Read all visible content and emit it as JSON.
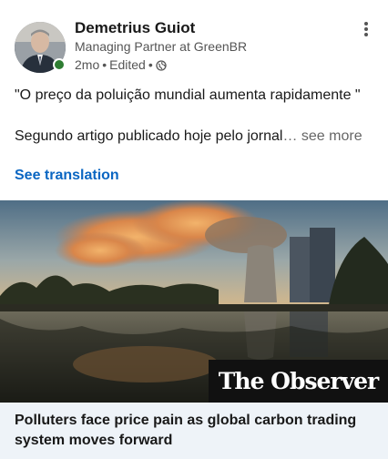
{
  "author": {
    "name": "Demetrius Guiot",
    "headline": "Managing Partner at GreenBR",
    "time": "2mo",
    "edited": "Edited",
    "separator": "•",
    "visibility_icon": "globe-icon"
  },
  "post": {
    "line1": "\"O preço da poluição mundial aumenta rapidamente \"",
    "line2": "Segundo artigo publicado hoje pelo jornal",
    "ellipsis": "…",
    "see_more": "see more",
    "translation": "See translation"
  },
  "article": {
    "publisher": "The Observer",
    "title": "Polluters face price pain as global carbon trading system moves forward"
  },
  "colors": {
    "link_blue": "#0a66c2",
    "presence_green": "#2e7d32",
    "caption_bg": "#eef3f8"
  }
}
